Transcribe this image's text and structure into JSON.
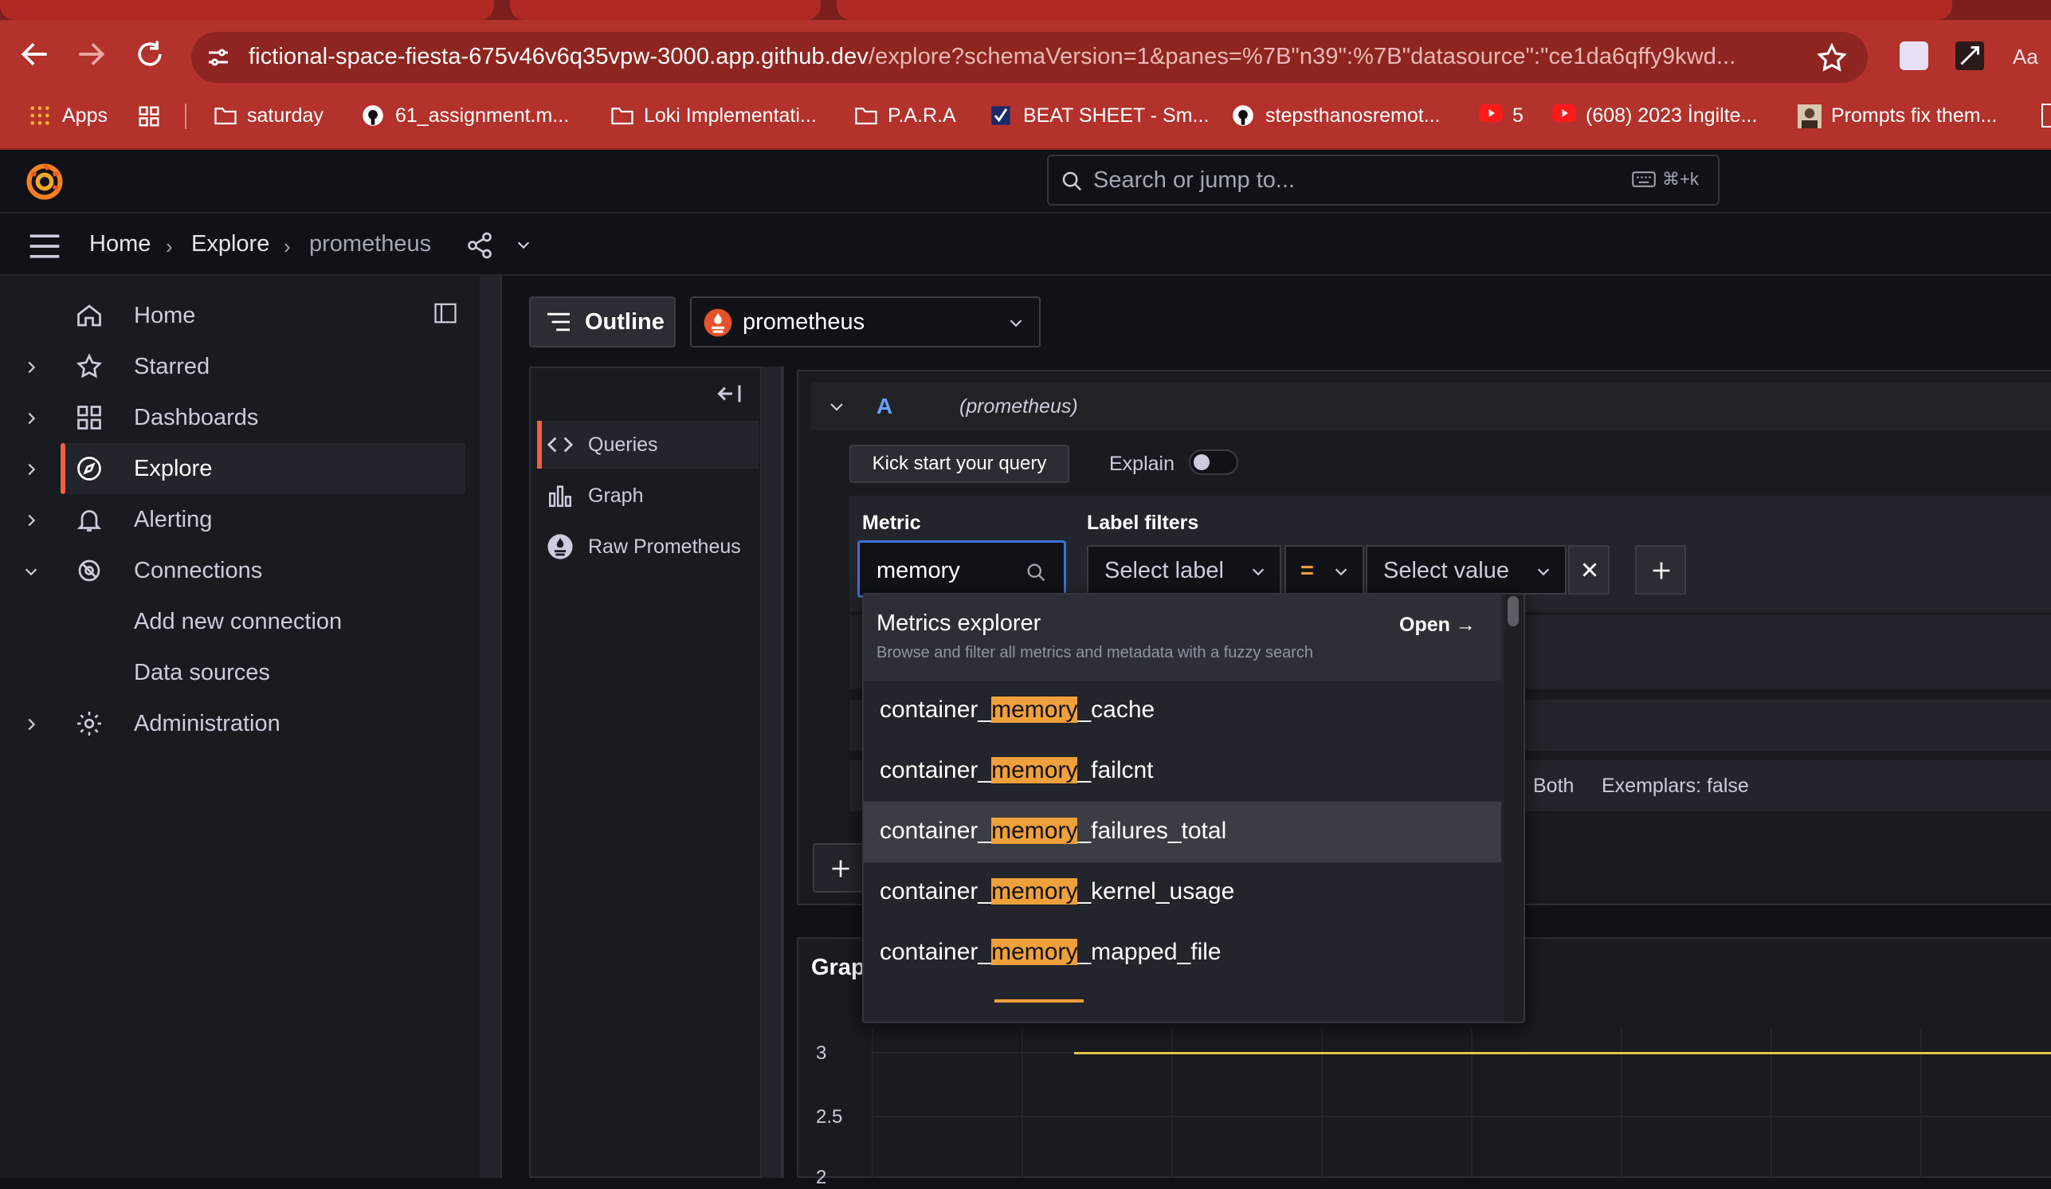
{
  "browser": {
    "url_host": "fictional-space-fiesta-675v46v6q35vpw-3000.app.github.dev",
    "url_rest": "/explore?schemaVersion=1&panes=%7B\"n39\":%7B\"datasource\":\"ce1da6qffy9kwd...",
    "bookmarks": [
      "Apps",
      "saturday",
      "61_assignment.m...",
      "Loki Implementati...",
      "P.A.R.A",
      "BEAT SHEET - Sm...",
      "stepsthanosremot...",
      "5",
      "(608) 2023 İngilte...",
      "Prompts fix them..."
    ]
  },
  "topbar": {
    "search_placeholder": "Search or jump to...",
    "shortcut": "⌘+k"
  },
  "breadcrumb": [
    "Home",
    "Explore",
    "prometheus"
  ],
  "sidebar": {
    "items": [
      {
        "label": "Home",
        "icon": "home-icon",
        "caret": ""
      },
      {
        "label": "Starred",
        "icon": "star-icon",
        "caret": "›"
      },
      {
        "label": "Dashboards",
        "icon": "apps-icon",
        "caret": "›"
      },
      {
        "label": "Explore",
        "icon": "compass-icon",
        "caret": "›",
        "active": true
      },
      {
        "label": "Alerting",
        "icon": "bell-icon",
        "caret": "›"
      },
      {
        "label": "Connections",
        "icon": "connections-icon",
        "caret": "⌄"
      },
      {
        "label": "Add new connection",
        "icon": "",
        "caret": ""
      },
      {
        "label": "Data sources",
        "icon": "",
        "caret": ""
      },
      {
        "label": "Administration",
        "icon": "gear-icon",
        "caret": "›"
      }
    ]
  },
  "toolbar": {
    "outline_label": "Outline",
    "datasource": "prometheus"
  },
  "outline": {
    "items": [
      {
        "label": "Queries",
        "icon": "code-icon"
      },
      {
        "label": "Graph",
        "icon": "bar-chart-icon"
      },
      {
        "label": "Raw Prometheus",
        "icon": "prometheus-icon"
      }
    ]
  },
  "query": {
    "ref_id": "A",
    "datasource_label": "(prometheus)",
    "kick_start": "Kick start your query",
    "explain_label": "Explain",
    "metric_label": "Metric",
    "label_filters_label": "Label filters",
    "metric_value": "memory",
    "select_label": "Select label",
    "operator": "=",
    "select_value": "Select value",
    "options_type": "Both",
    "options_exemplars": "Exemplars: false"
  },
  "dropdown": {
    "explorer_title": "Metrics explorer",
    "explorer_open": "Open →",
    "explorer_desc": "Browse and filter all metrics and metadata with a fuzzy search",
    "options": [
      {
        "prefix": "container_",
        "match": "memory",
        "suffix": "_cache"
      },
      {
        "prefix": "container_",
        "match": "memory",
        "suffix": "_failcnt"
      },
      {
        "prefix": "container_",
        "match": "memory",
        "suffix": "_failures_total",
        "highlighted": true
      },
      {
        "prefix": "container_",
        "match": "memory",
        "suffix": "_kernel_usage"
      },
      {
        "prefix": "container_",
        "match": "memory",
        "suffix": "_mapped_file"
      }
    ]
  },
  "graph": {
    "title": "Grap",
    "yticks": [
      "3",
      "2.5",
      "2"
    ]
  },
  "colors": {
    "accent": "#f55f3e",
    "query_id": "#6e9fff",
    "highlight": "#f0a03a",
    "series": "#e0c34a"
  }
}
